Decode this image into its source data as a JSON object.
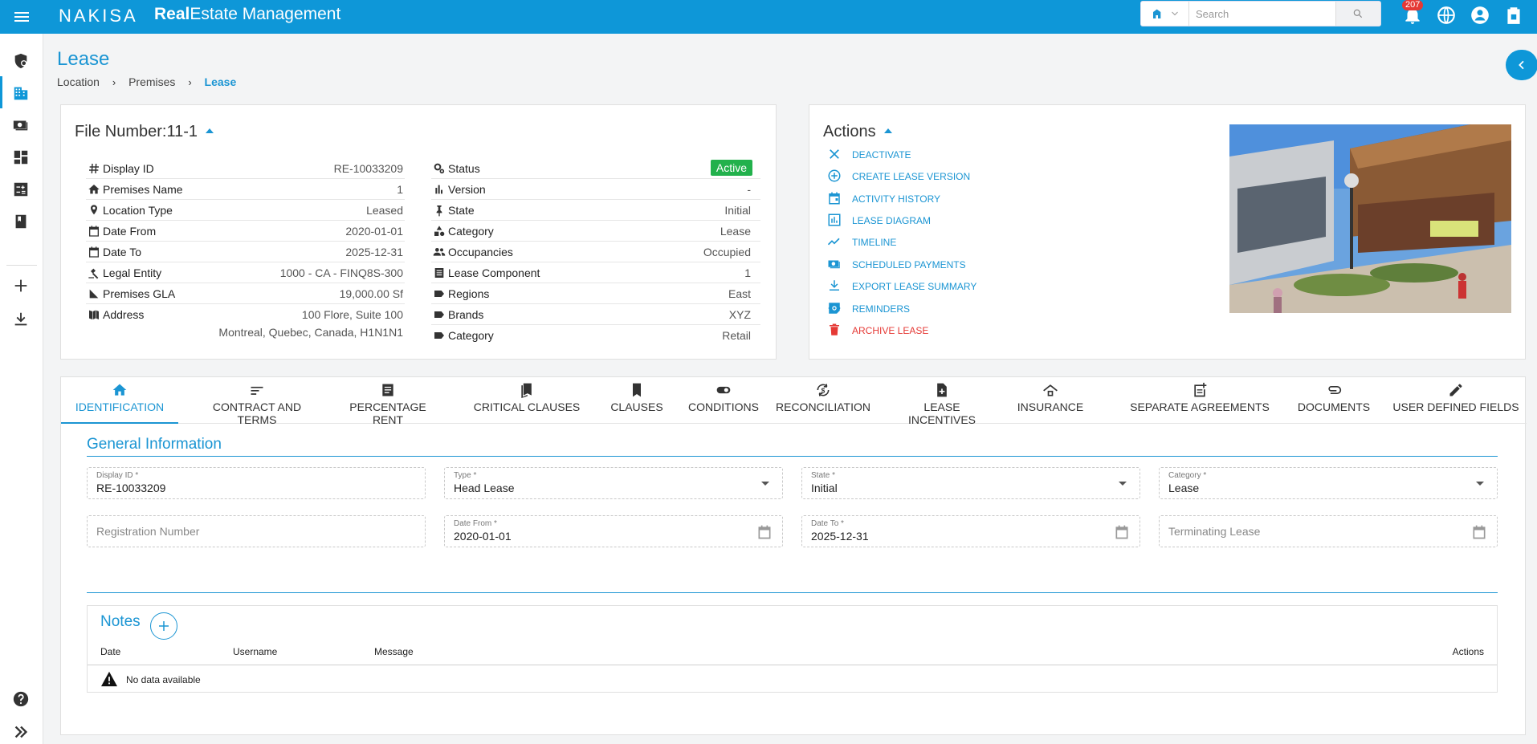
{
  "topbar": {
    "brand": "NAKISA",
    "app_bold": "Real",
    "app_rest": "Estate Management",
    "search_placeholder": "Search",
    "notification_count": "207",
    "icons": [
      "menu-icon",
      "building-type-icon",
      "search-icon",
      "bell-icon",
      "globe-icon",
      "account-icon",
      "clipboard-icon"
    ]
  },
  "sidebar": {
    "items": [
      "security-icon",
      "building-icon",
      "payments-icon",
      "dashboard-icon",
      "calculator-icon",
      "book-icon",
      "add-icon",
      "download-icon",
      "help-icon",
      "expand-icon"
    ]
  },
  "header": {
    "title": "Lease",
    "breadcrumb": [
      "Location",
      "Premises",
      "Lease"
    ],
    "sep": "›"
  },
  "file": {
    "title": "File Number:11-1",
    "left": [
      {
        "key": "Display ID",
        "value": "RE-10033209"
      },
      {
        "key": "Premises Name",
        "value": "1"
      },
      {
        "key": "Location Type",
        "value": "Leased"
      },
      {
        "key": "Date From",
        "value": "2020-01-01"
      },
      {
        "key": "Date To",
        "value": "2025-12-31"
      },
      {
        "key": "Legal Entity",
        "value": "1000 - CA - FINQ8S-300"
      },
      {
        "key": "Premises GLA",
        "value": "19,000.00 Sf"
      },
      {
        "key": "Address",
        "value": "100 Flore, Suite 100",
        "value2": "Montreal, Quebec, Canada, H1N1N1"
      }
    ],
    "right": [
      {
        "key": "Status",
        "value": "Active"
      },
      {
        "key": "Version",
        "value": "-"
      },
      {
        "key": "State",
        "value": "Initial"
      },
      {
        "key": "Category",
        "value": "Lease"
      },
      {
        "key": "Occupancies",
        "value": "Occupied"
      },
      {
        "key": "Lease Component",
        "value": "1"
      },
      {
        "key": "Regions",
        "value": "East"
      },
      {
        "key": "Brands",
        "value": "XYZ"
      },
      {
        "key": "Category",
        "value": "Retail"
      }
    ]
  },
  "actions": {
    "title": "Actions",
    "items": [
      {
        "label": "DEACTIVATE"
      },
      {
        "label": "CREATE LEASE VERSION"
      },
      {
        "label": "ACTIVITY HISTORY"
      },
      {
        "label": "LEASE DIAGRAM"
      },
      {
        "label": "TIMELINE"
      },
      {
        "label": "SCHEDULED PAYMENTS"
      },
      {
        "label": "EXPORT LEASE SUMMARY"
      },
      {
        "label": "REMINDERS"
      },
      {
        "label": "ARCHIVE LEASE"
      }
    ]
  },
  "tabs": [
    {
      "label": "IDENTIFICATION"
    },
    {
      "label": "CONTRACT AND TERMS"
    },
    {
      "label": "PERCENTAGE RENT"
    },
    {
      "label": "CRITICAL CLAUSES"
    },
    {
      "label": "CLAUSES"
    },
    {
      "label": "CONDITIONS"
    },
    {
      "label": "RECONCILIATION"
    },
    {
      "label": "LEASE INCENTIVES"
    },
    {
      "label": "INSURANCE"
    },
    {
      "label": "SEPARATE AGREEMENTS"
    },
    {
      "label": "DOCUMENTS"
    },
    {
      "label": "USER DEFINED FIELDS"
    }
  ],
  "general": {
    "title": "General Information",
    "display_id": {
      "label": "Display ID *",
      "value": "RE-10033209"
    },
    "type": {
      "label": "Type *",
      "value": "Head Lease"
    },
    "state": {
      "label": "State *",
      "value": "Initial"
    },
    "category": {
      "label": "Category *",
      "value": "Lease"
    },
    "registration": {
      "placeholder": "Registration Number"
    },
    "date_from": {
      "label": "Date From *",
      "value": "2020-01-01"
    },
    "date_to": {
      "label": "Date To *",
      "value": "2025-12-31"
    },
    "terminating": {
      "placeholder": "Terminating Lease"
    }
  },
  "notes": {
    "title": "Notes",
    "columns": [
      "Date",
      "Username",
      "Message",
      "Actions"
    ],
    "empty": "No data available"
  },
  "colors": {
    "accent": "#0e97d8",
    "active": "#22b14c",
    "danger": "#e53935"
  }
}
